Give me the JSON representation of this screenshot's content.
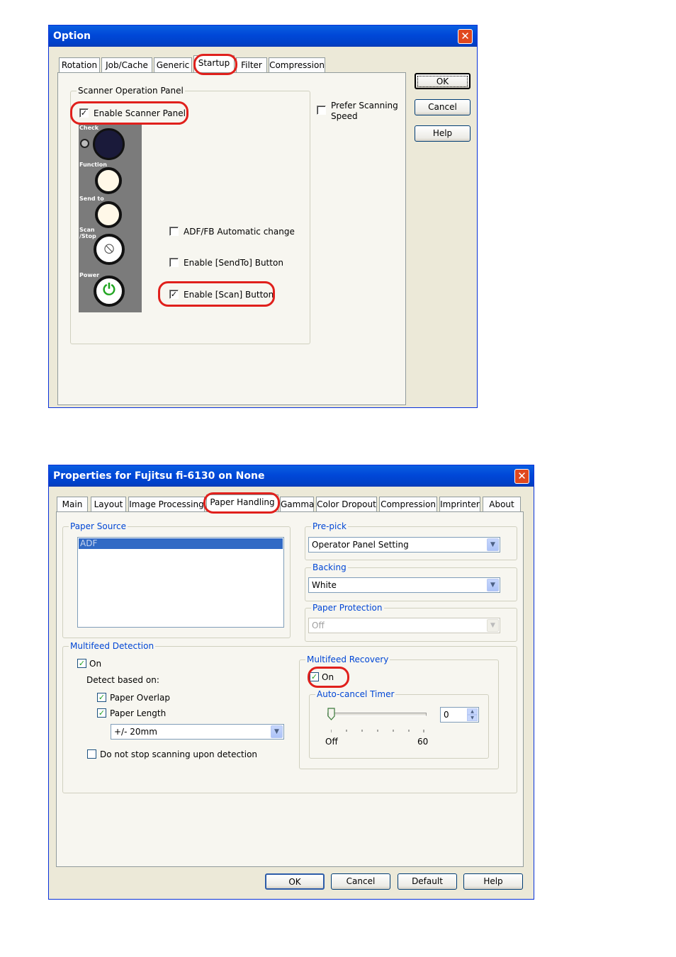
{
  "option_dialog": {
    "title": "Option",
    "tabs": [
      "Rotation",
      "Job/Cache",
      "Generic",
      "Startup",
      "Filter",
      "Compression"
    ],
    "active_tab": "Startup",
    "buttons": {
      "ok": "OK",
      "cancel": "Cancel",
      "help": "Help"
    },
    "scanner_operation_panel": {
      "group_label": "Scanner Operation Panel",
      "enable_scanner_panel": {
        "label": "Enable Scanner Panel",
        "checked": true
      },
      "panel_buttons": [
        "Check",
        "Function",
        "Send to",
        "Scan /Stop",
        "Power"
      ],
      "adf_fb_auto_change": {
        "label": "ADF/FB Automatic change",
        "checked": false
      },
      "enable_sendto": {
        "label": "Enable [SendTo] Button",
        "checked": false
      },
      "enable_scan": {
        "label": "Enable [Scan] Button",
        "checked": true
      }
    },
    "prefer_scanning_speed": {
      "label_line1": "Prefer Scanning",
      "label_line2": "Speed",
      "checked": false
    }
  },
  "properties_dialog": {
    "title": "Properties for Fujitsu fi-6130 on None",
    "tabs": [
      "Main",
      "Layout",
      "Image Processing",
      "Paper Handling",
      "Gamma",
      "Color Dropout",
      "Compression",
      "Imprinter",
      "About"
    ],
    "active_tab": "Paper Handling",
    "paper_source": {
      "label": "Paper Source",
      "items": [
        "ADF"
      ],
      "selected": "ADF"
    },
    "pre_pick": {
      "label": "Pre-pick",
      "value": "Operator Panel Setting"
    },
    "backing": {
      "label": "Backing",
      "value": "White"
    },
    "paper_protection": {
      "label": "Paper Protection",
      "value": "Off",
      "disabled": true
    },
    "multifeed_detection": {
      "label": "Multifeed Detection",
      "on": {
        "label": "On",
        "checked": true
      },
      "detect_based_on": "Detect based on:",
      "paper_overlap": {
        "label": "Paper Overlap",
        "checked": true
      },
      "paper_length": {
        "label": "Paper Length",
        "checked": true
      },
      "length_tolerance": "+/- 20mm",
      "do_not_stop": {
        "label": "Do not stop scanning upon detection",
        "checked": false
      }
    },
    "multifeed_recovery": {
      "label": "Multifeed Recovery",
      "on": {
        "label": "On",
        "checked": true
      },
      "auto_cancel_timer": {
        "label": "Auto-cancel Timer",
        "min_label": "Off",
        "max_label": "60",
        "value": "0",
        "slider_fraction": 0
      }
    },
    "buttons": {
      "ok": "OK",
      "cancel": "Cancel",
      "default": "Default",
      "help": "Help"
    }
  },
  "colors": {
    "highlight": "#e0201c",
    "title_bar": "#0048d8",
    "group_label_blue": "#0046d5",
    "check_green": "#21a121"
  }
}
